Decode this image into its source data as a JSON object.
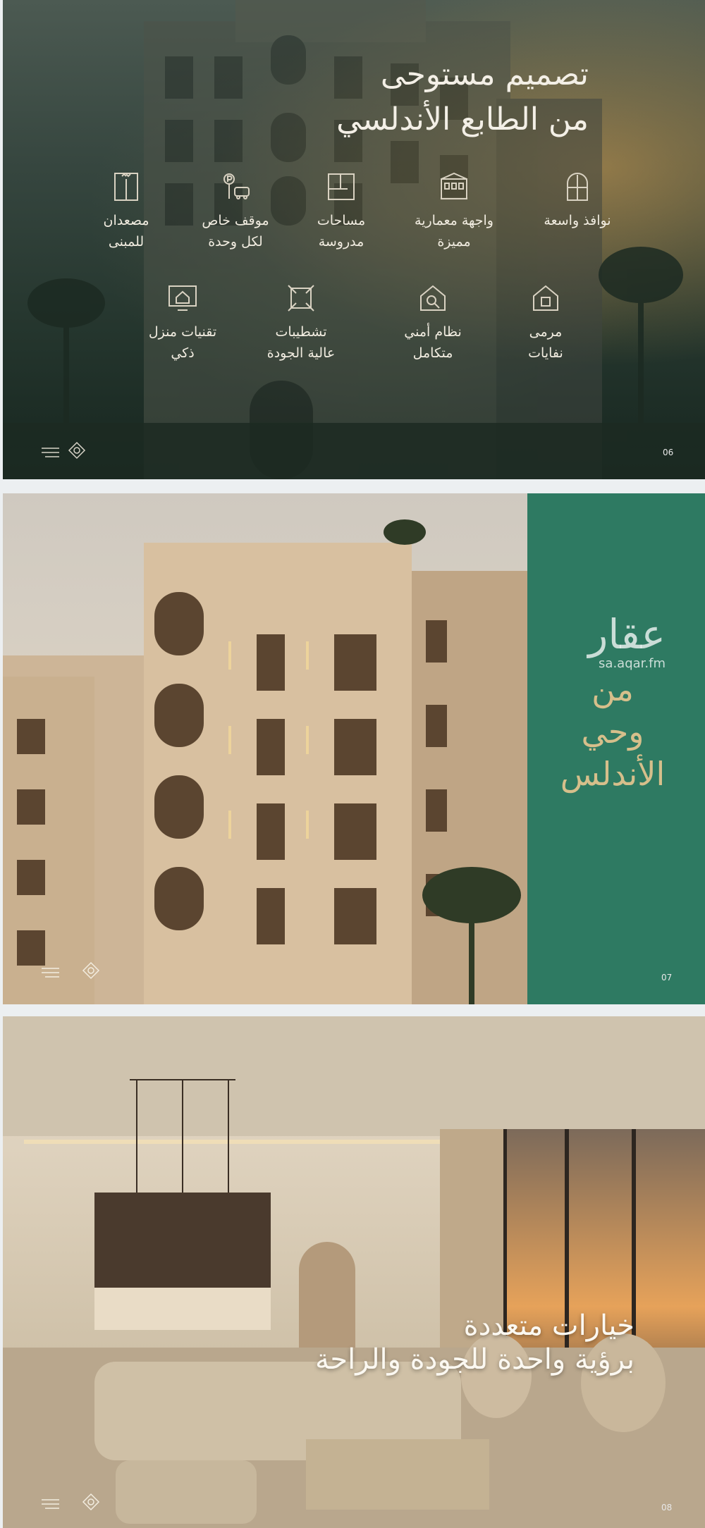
{
  "slides": [
    {
      "title_line1": "تصميم مستوحى",
      "title_line2": "من الطابع الأندلسي",
      "features_row1": [
        {
          "label1": "نوافذ واسعة",
          "label2": "",
          "icon": "window-icon"
        },
        {
          "label1": "واجهة معمارية",
          "label2": "مميزة",
          "icon": "facade-icon"
        },
        {
          "label1": "مساحات",
          "label2": "مدروسة",
          "icon": "floorplan-icon"
        },
        {
          "label1": "موقف خاص",
          "label2": "لكل وحدة",
          "icon": "parking-icon"
        },
        {
          "label1": "مصعدان",
          "label2": "للمبنى",
          "icon": "elevator-icon"
        }
      ],
      "features_row2": [
        {
          "label1": "مرمى",
          "label2": "نفايات",
          "icon": "trash-chute-icon"
        },
        {
          "label1": "نظام أمني",
          "label2": "متكامل",
          "icon": "security-icon"
        },
        {
          "label1": "تشطيبات",
          "label2": "عالية الجودة",
          "icon": "finishes-icon"
        },
        {
          "label1": "تقنيات منزل",
          "label2": "ذكي",
          "icon": "smart-home-icon"
        }
      ],
      "page_number": "06"
    },
    {
      "watermark_ar": "عقار",
      "watermark_url": "sa.aqar.fm",
      "text_line1": "من",
      "text_line2": "وحي",
      "text_line3": "الأندلس",
      "page_number": "07"
    },
    {
      "title_line1": "خيارات متعددة",
      "title_line2": "برؤية واحدة للجودة والراحة",
      "page_number": "08"
    }
  ],
  "colors": {
    "panel_green": "#2e7a62",
    "gold_text": "#d6bf8b",
    "dark_overlay": "#1f3129"
  }
}
